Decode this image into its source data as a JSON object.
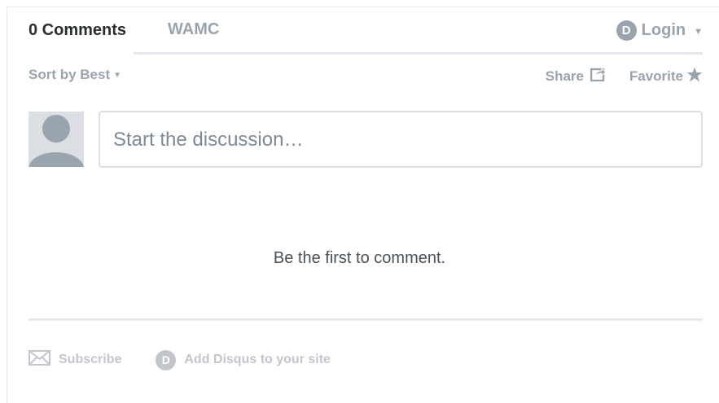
{
  "nav": {
    "comments_tab": "0 Comments",
    "site_tab": "WAMC",
    "login_label": "Login",
    "logo_letter": "D"
  },
  "toolbar": {
    "sort_label": "Sort by Best",
    "share_label": "Share",
    "favorite_label": "Favorite"
  },
  "composer": {
    "placeholder": "Start the discussion…"
  },
  "empty_state": {
    "message": "Be the first to comment."
  },
  "footer": {
    "subscribe_label": "Subscribe",
    "add_disqus_label": "Add Disqus to your site",
    "logo_letter": "D"
  },
  "colors": {
    "text": "#2a2e2e",
    "muted": "#9aa4ae",
    "footer_muted": "#c2c6cc",
    "border": "#dbdfe4",
    "divider": "#e7e9ee"
  }
}
